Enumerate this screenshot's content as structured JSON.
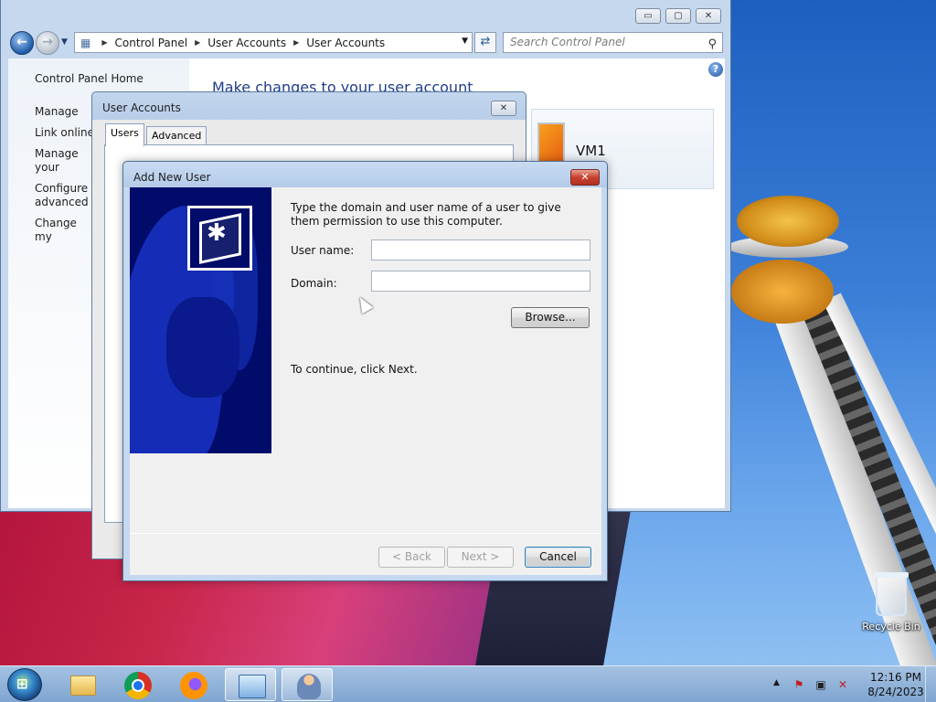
{
  "control_panel": {
    "address": {
      "crumbs": [
        "Control Panel",
        "User Accounts",
        "User Accounts"
      ]
    },
    "search_placeholder": "Search Control Panel",
    "sidebar": {
      "home": "Control Panel Home",
      "links": [
        "Manage your",
        "Link online I",
        "Manage your certificates",
        "Configure advanced profile properties",
        "Change my environment variables"
      ]
    },
    "heading": "Make changes to your user account",
    "user_name": "VM1",
    "window_buttons": {
      "minimize": "▭",
      "maximize": "▢",
      "close": "✕"
    }
  },
  "user_accounts_dialog": {
    "title": "User Accounts",
    "tabs": [
      "Users",
      "Advanced"
    ],
    "close": "✕"
  },
  "add_new_user": {
    "title": "Add New User",
    "close": "✕",
    "instructions": "Type the domain and user name of a user to give them permission to use this computer.",
    "user_name_label": "User name:",
    "user_name_value": "",
    "domain_label": "Domain:",
    "domain_value": "",
    "browse_label": "Browse...",
    "continue_text": "To continue, click Next.",
    "back_label": "< Back",
    "next_label": "Next >",
    "cancel_label": "Cancel"
  },
  "desktop": {
    "recycle_bin_label": "Recycle Bin"
  },
  "taskbar": {
    "apps": [
      "folder-icon",
      "chrome-icon",
      "firefox-icon",
      "control-panel-icon",
      "user-accounts-icon"
    ],
    "clock_time": "12:16 PM",
    "clock_date": "8/24/2023"
  },
  "colors": {
    "banner_background": "#000b6a",
    "heading_blue": "#1e3c8c",
    "close_red": "#c7402d"
  }
}
